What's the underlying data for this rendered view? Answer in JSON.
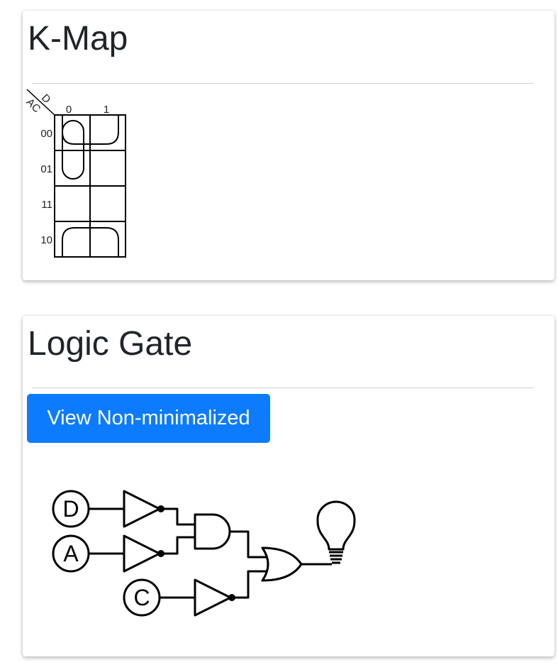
{
  "kmap_card": {
    "title": "K-Map",
    "row_variables": "AC",
    "col_variables": "D",
    "col_headers": [
      "0",
      "1"
    ],
    "row_headers": [
      "00",
      "01",
      "11",
      "10"
    ],
    "cells": [
      [
        "1",
        "1"
      ],
      [
        "1",
        "0"
      ],
      [
        "0",
        "0"
      ],
      [
        "1",
        "1"
      ]
    ]
  },
  "gate_card": {
    "title": "Logic Gate",
    "toggle_button_label": "View Non-minimalized",
    "inputs": [
      "D",
      "A",
      "C"
    ],
    "output_icon": "light-bulb-icon"
  }
}
